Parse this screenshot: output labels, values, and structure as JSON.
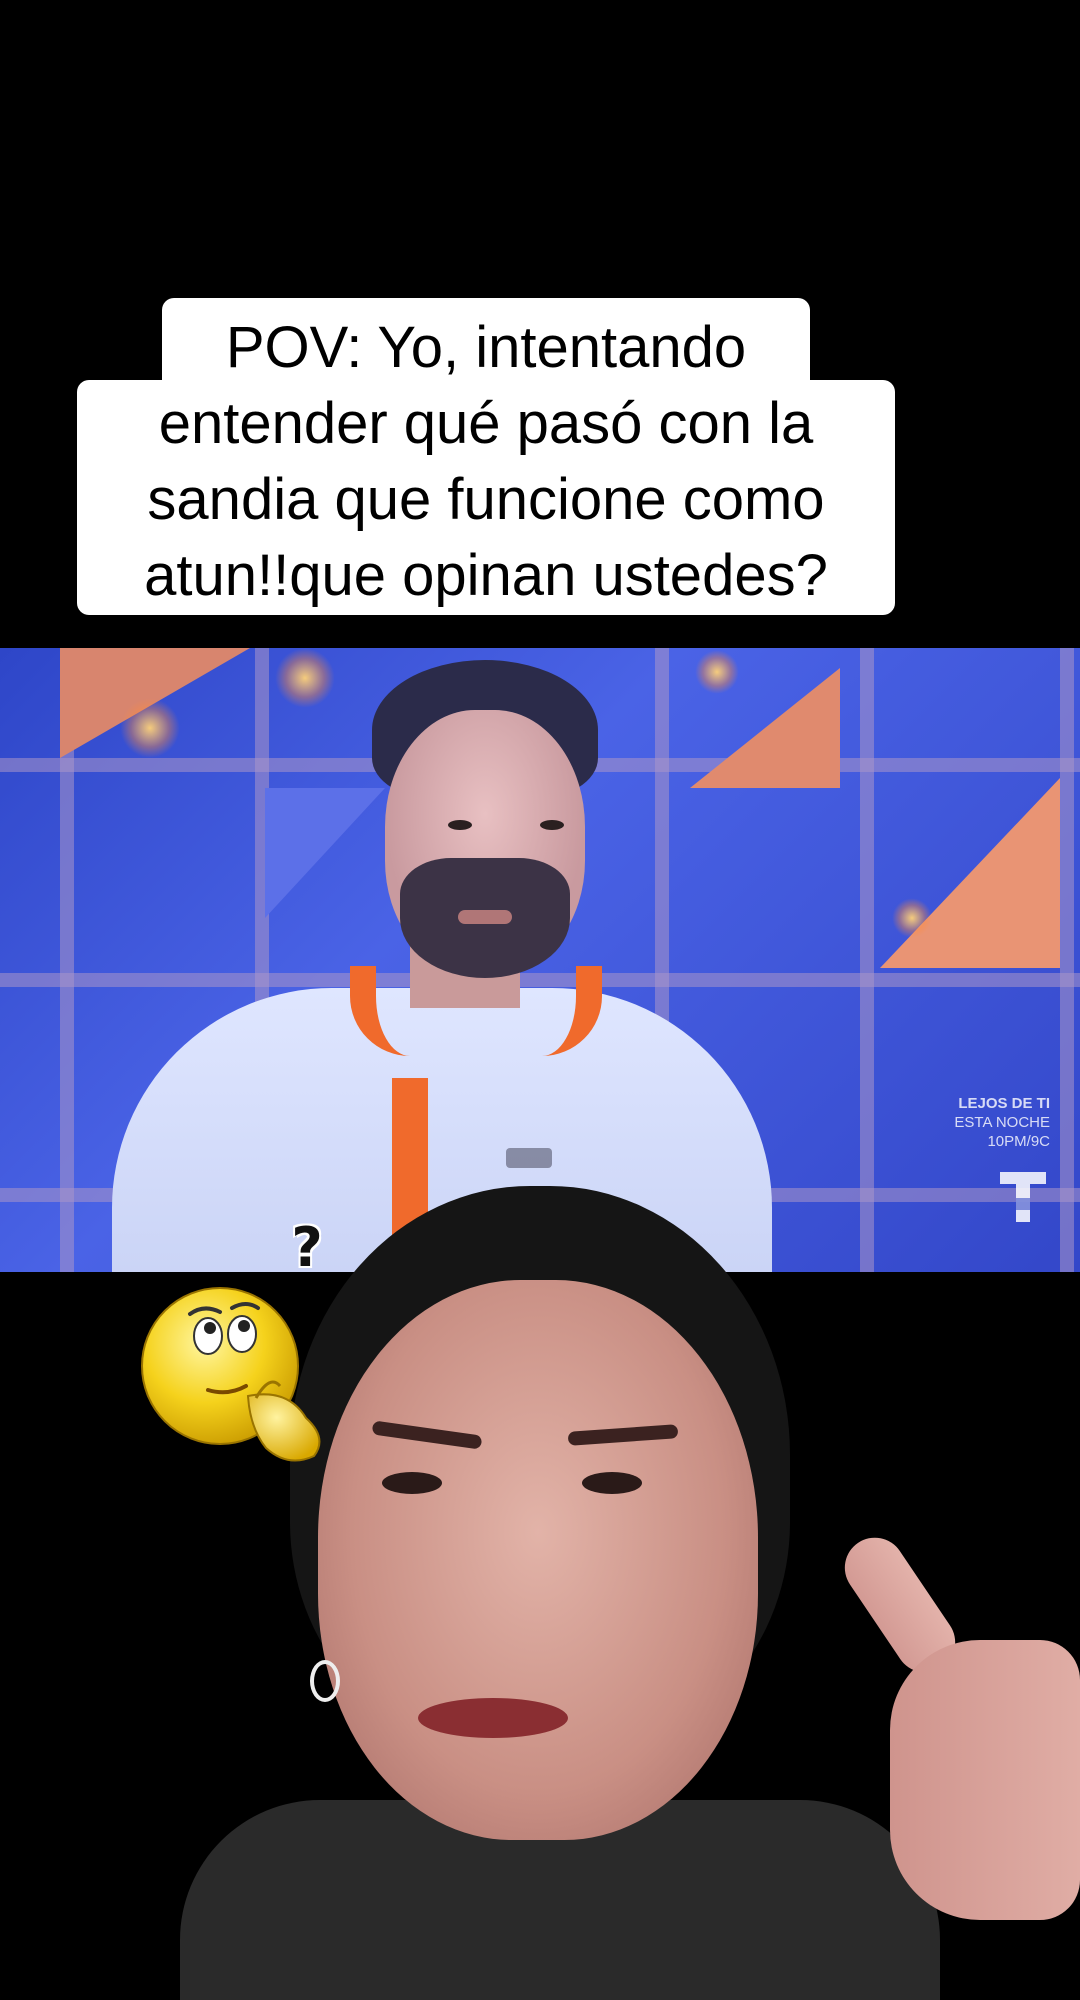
{
  "caption": {
    "line1": "POV: Yo, intentando",
    "line2": "entender qué pasó con la",
    "line3": "sandia que funcione como",
    "line4": "atun!!que opinan ustedes?"
  },
  "tv_clip": {
    "promo_title": "LEJOS DE TI",
    "promo_line2": "ESTA NOCHE",
    "promo_time": "10PM/9C",
    "network_logo_icon": "telemundo-logo-icon"
  },
  "sticker": {
    "emoji_icon": "thinking-face-icon",
    "symbol": "?"
  },
  "colors": {
    "background": "#000000",
    "caption_bg": "#ffffff",
    "caption_text": "#000000",
    "chef_accent": "#f06a2c",
    "studio_blue": "#3a52d8"
  }
}
